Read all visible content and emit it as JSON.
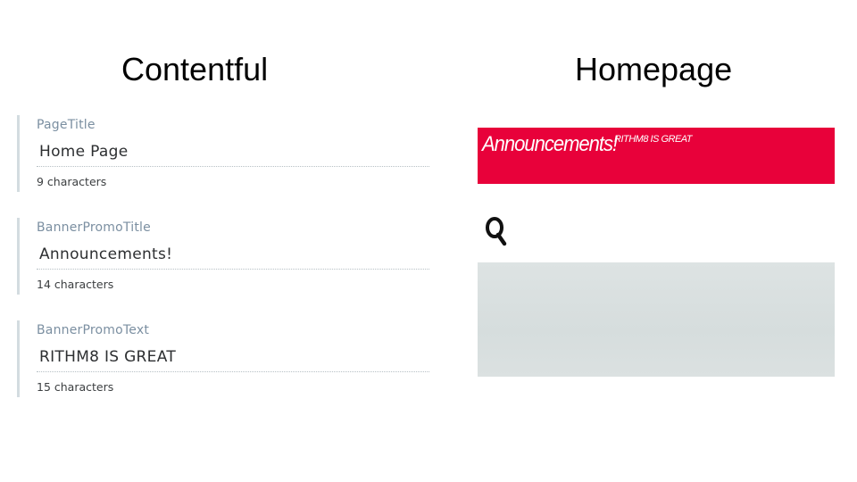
{
  "headings": {
    "left": "Contentful",
    "right": "Homepage"
  },
  "contentful_fields": [
    {
      "label": "PageTitle",
      "value": "Home Page",
      "count": "9 characters"
    },
    {
      "label": "BannerPromoTitle",
      "value": "Announcements!",
      "count": "14 characters"
    },
    {
      "label": "BannerPromoText",
      "value": "RITHM8 IS GREAT",
      "count": "15 characters"
    }
  ],
  "homepage": {
    "banner": {
      "title": "Announcements!",
      "text": "RITHM8 IS GREAT",
      "background_color": "#e8013a"
    },
    "search_icon": "search-icon",
    "hero_image_color": "#d9e0e0"
  },
  "colors": {
    "field_border": "#d3dce0",
    "label_text": "#7b8fa1"
  }
}
